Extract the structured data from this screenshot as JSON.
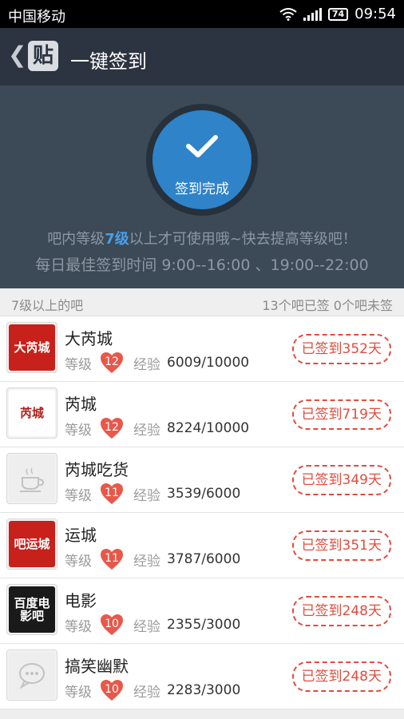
{
  "status_bar": {
    "carrier": "中国移动",
    "battery": "74",
    "time": "09:54"
  },
  "app_bar": {
    "logo_char": "贴",
    "title": "一键签到"
  },
  "hero": {
    "button_label": "签到完成",
    "notice_prefix": "吧内等级",
    "notice_level": "7级",
    "notice_suffix": "以上才可使用哦~快去提高等级吧！",
    "best_time": "每日最佳签到时间  9:00--16:00 、19:00--22:00"
  },
  "list_header": {
    "left": "7级以上的吧",
    "right": "13个吧已签 0个吧未签"
  },
  "labels": {
    "level": "等级",
    "exp": "经验"
  },
  "bars": [
    {
      "name": "大芮城",
      "level": "12",
      "exp": "6009/10000",
      "status": "已签到352天",
      "avatar": "大芮城",
      "avatar_color": "#c8201a"
    },
    {
      "name": "芮城",
      "level": "12",
      "exp": "8224/10000",
      "status": "已签到719天",
      "avatar": "芮城",
      "avatar_color": "#ffffff"
    },
    {
      "name": "芮城吃货",
      "level": "11",
      "exp": "3539/6000",
      "status": "已签到349天",
      "avatar": "cup-icon",
      "avatar_color": "#eeeeee"
    },
    {
      "name": "运城",
      "level": "11",
      "exp": "3787/6000",
      "status": "已签到351天",
      "avatar": "吧运城",
      "avatar_color": "#c8201a"
    },
    {
      "name": "电影",
      "level": "10",
      "exp": "2355/3000",
      "status": "已签到248天",
      "avatar": "百度电影吧",
      "avatar_color": "#1a1a1a"
    },
    {
      "name": "搞笑幽默",
      "level": "10",
      "exp": "2283/3000",
      "status": "已签到248天",
      "avatar": "chat-icon",
      "avatar_color": "#eeeeee"
    }
  ],
  "colors": {
    "accent": "#2f83c9",
    "hero_bg": "#3c4956",
    "app_bar": "#2b3440",
    "stamp": "#e24b3c",
    "heart": "#e8584a"
  }
}
